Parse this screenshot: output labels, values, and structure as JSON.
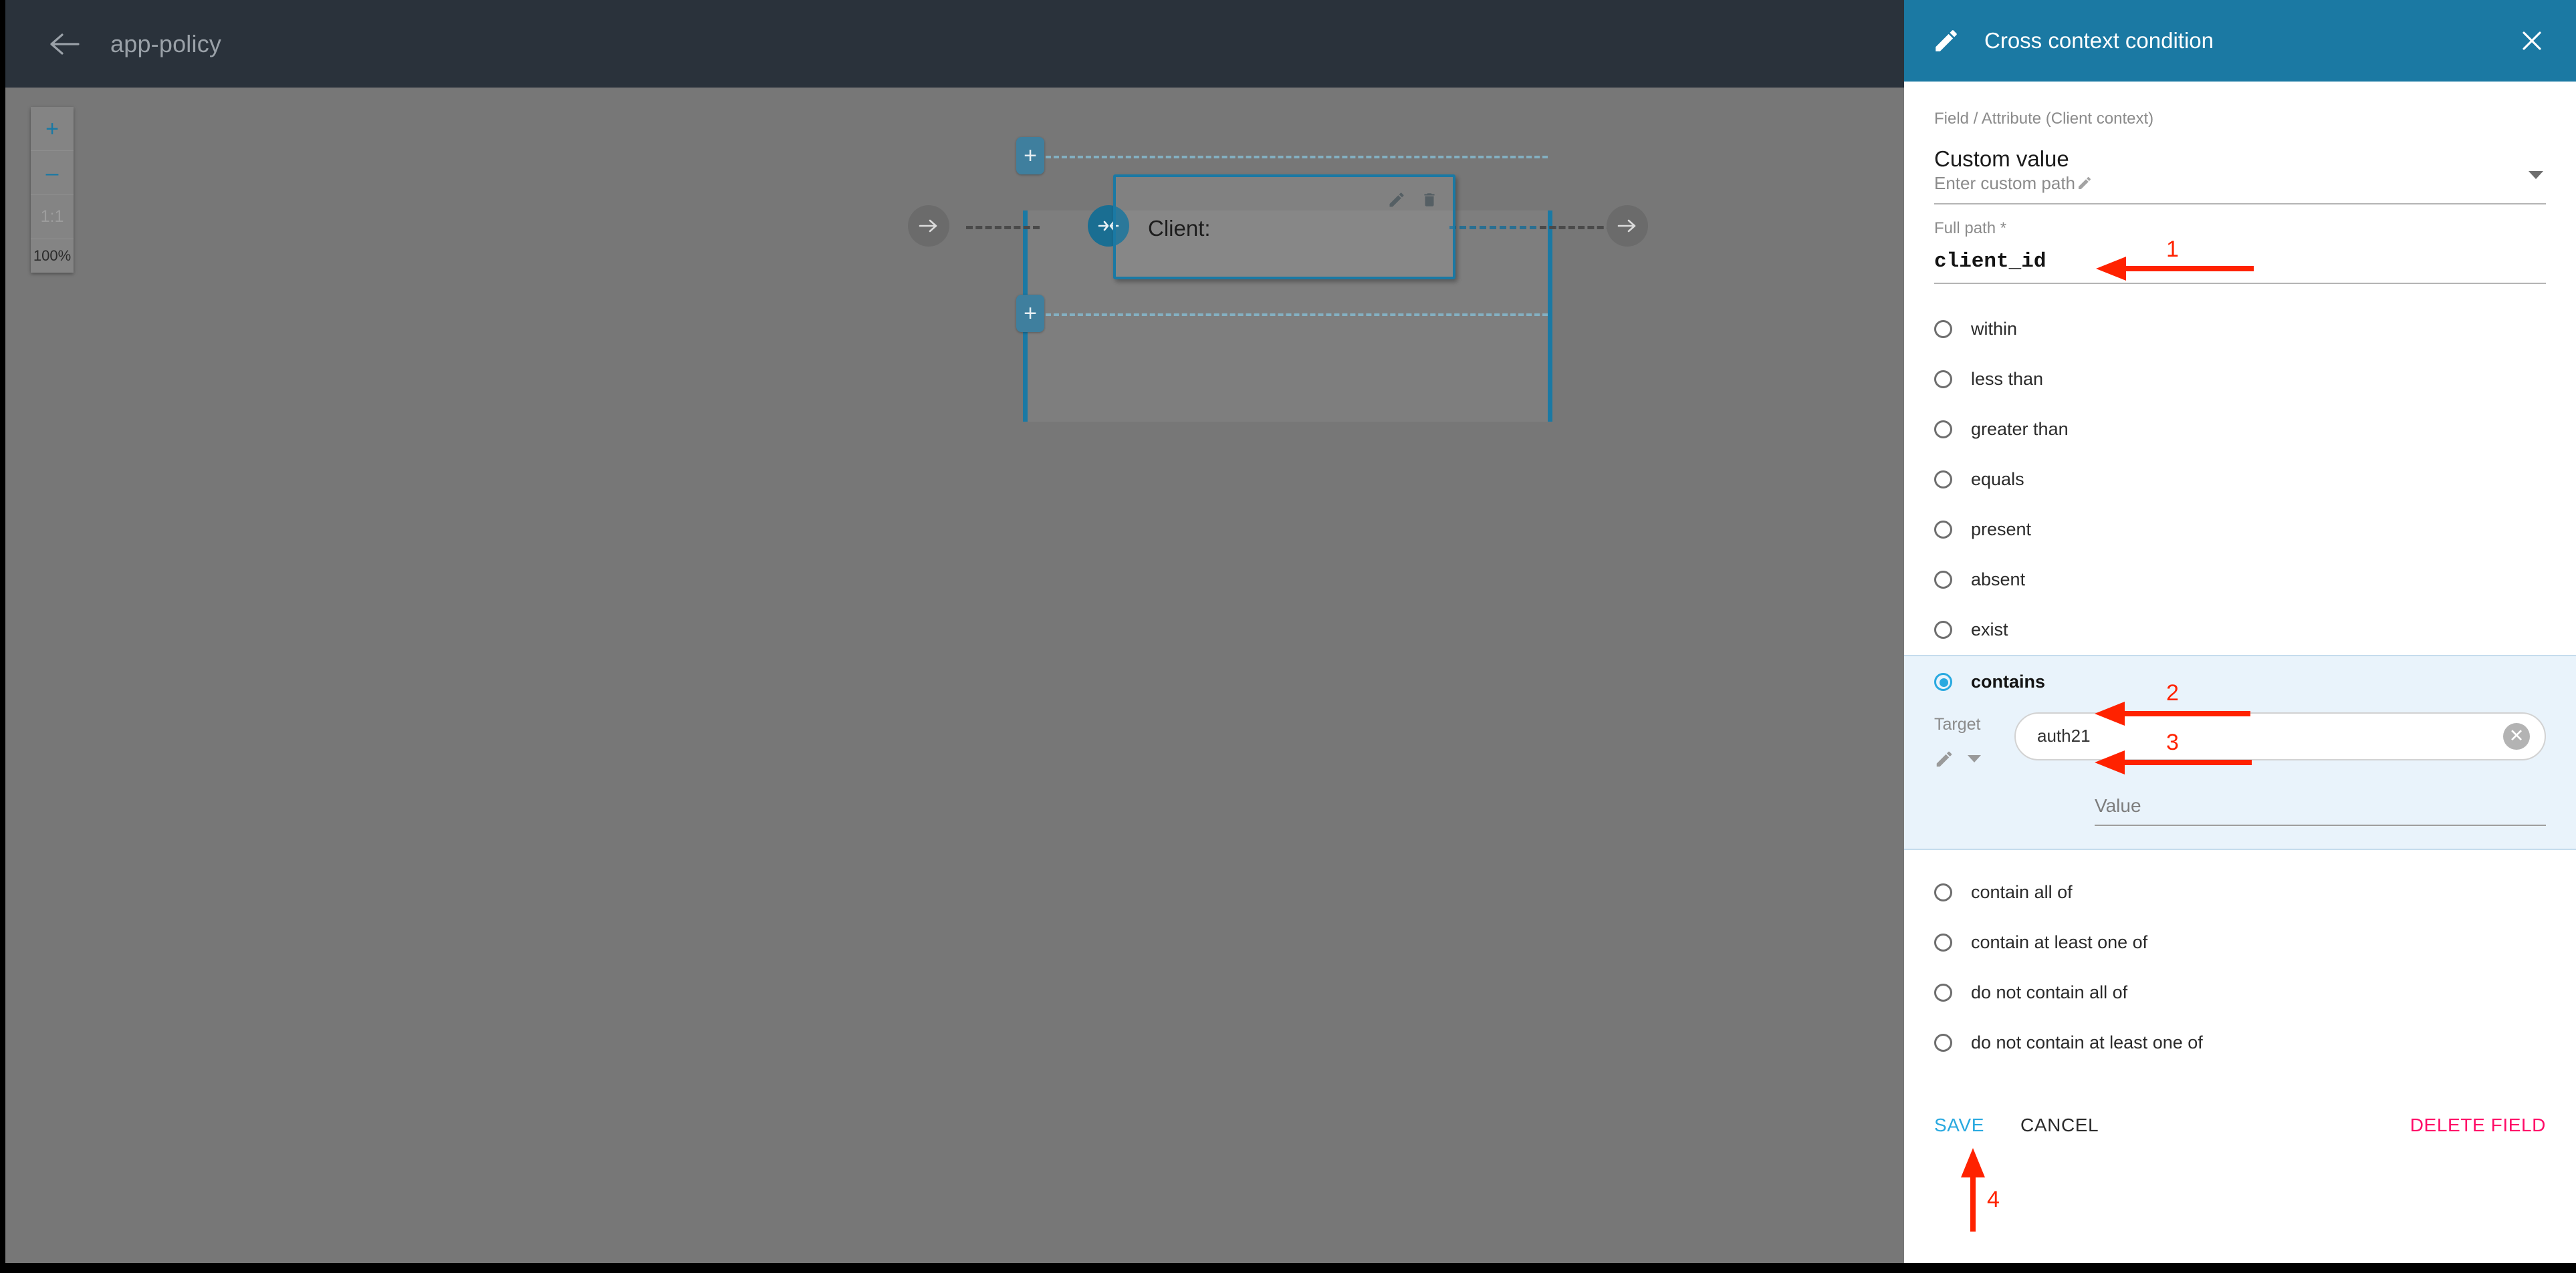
{
  "window": {
    "app_title": "app-policy",
    "back_icon": "back-arrow-icon"
  },
  "canvas": {
    "zoom_controls": {
      "zoom_in": "+",
      "zoom_out": "–",
      "fit": "1:1",
      "level": "100%"
    },
    "node": {
      "label": "Client:",
      "edit_icon": "pencil-icon",
      "delete_icon": "trash-icon"
    },
    "plus_buttons": [
      "+",
      "+"
    ]
  },
  "panel": {
    "title": "Cross context condition",
    "header_icon": "pencil-icon",
    "close_icon": "close-icon",
    "accent_color": "#1b79a3",
    "field_attribute": {
      "label": "Field / Attribute (Client context)",
      "value": "Custom value",
      "sub_value": "Enter custom path",
      "edit_icon": "pencil-icon",
      "caret_icon": "chevron-down-icon"
    },
    "full_path": {
      "label": "Full path *",
      "value": "client_id"
    },
    "operators_before": [
      {
        "label": "within",
        "selected": false
      },
      {
        "label": "less than",
        "selected": false
      },
      {
        "label": "greater than",
        "selected": false
      },
      {
        "label": "equals",
        "selected": false
      },
      {
        "label": "present",
        "selected": false
      },
      {
        "label": "absent",
        "selected": false
      },
      {
        "label": "exist",
        "selected": false
      }
    ],
    "selected_operator": {
      "label": "contains",
      "selected": true,
      "target": {
        "label": "Target",
        "chip_value": "auth21",
        "clear_icon": "clear-circle-icon",
        "edit_icon": "pencil-icon",
        "caret_icon": "chevron-down-icon"
      },
      "value_field": {
        "placeholder": "Value",
        "value": ""
      }
    },
    "operators_after": [
      {
        "label": "contain all of",
        "selected": false
      },
      {
        "label": "contain at least one of",
        "selected": false
      },
      {
        "label": "do not contain all of",
        "selected": false
      },
      {
        "label": "do not contain at least one of",
        "selected": false
      }
    ],
    "actions": {
      "save": "SAVE",
      "cancel": "CANCEL",
      "delete_field": "DELETE FIELD",
      "save_color": "#29a9e0",
      "delete_color": "#ff0a67"
    }
  },
  "annotations": {
    "color": "#ff2200",
    "markers": [
      {
        "number": "1",
        "target": "full-path-value"
      },
      {
        "number": "2",
        "target": "contains-radio"
      },
      {
        "number": "3",
        "target": "target-chip"
      },
      {
        "number": "4",
        "target": "save-button"
      }
    ]
  }
}
